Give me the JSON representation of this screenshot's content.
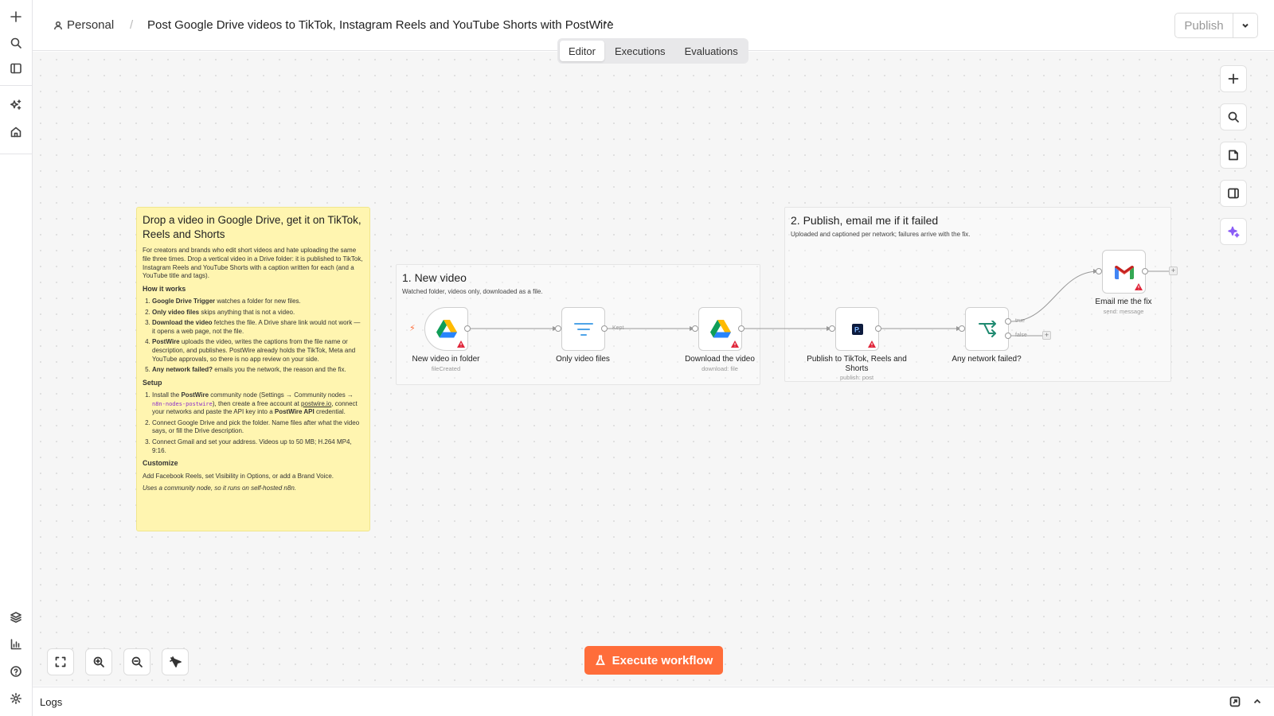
{
  "header": {
    "breadcrumb_project": "Personal",
    "breadcrumb_separator": "/",
    "workflow_title": "Post Google Drive videos to TikTok, Instagram Reels and YouTube Shorts with PostWire",
    "more_label": "···",
    "publish_label": "Publish"
  },
  "tabs": [
    "Editor",
    "Executions",
    "Evaluations"
  ],
  "active_tab": "Editor",
  "sticky": {
    "title": "Drop a video in Google Drive, get it on TikTok, Reels and Shorts",
    "intro": "For creators and brands who edit short videos and hate uploading the same file three times. Drop a vertical video in a Drive folder: it is published to TikTok, Instagram Reels and YouTube Shorts with a caption written for each (and a YouTube title and tags).",
    "how_heading": "How it works",
    "how_items": [
      {
        "b": "Google Drive Trigger",
        "t": " watches a folder for new files."
      },
      {
        "b": "Only video files",
        "t": " skips anything that is not a video."
      },
      {
        "b": "Download the video",
        "t": " fetches the file. A Drive share link would not work — it opens a web page, not the file."
      },
      {
        "b": "PostWire",
        "t": " uploads the video, writes the captions from the file name or description, and publishes. PostWire already holds the TikTok, Meta and YouTube approvals, so there is no app review on your side."
      },
      {
        "b": "Any network failed?",
        "t": " emails you the network, the reason and the fix."
      }
    ],
    "setup_heading": "Setup",
    "setup_1_a": "Install the ",
    "setup_1_b": "PostWire",
    "setup_1_c": " community node (Settings → Community nodes → ",
    "setup_1_code": "n8n-nodes-postwire",
    "setup_1_d": "), then create a free account at ",
    "setup_1_link": "postwire.io",
    "setup_1_e": ", connect your networks and paste the API key into a ",
    "setup_1_f": "PostWire API",
    "setup_1_g": " credential.",
    "setup_2": "Connect Google Drive and pick the folder. Name files after what the video says, or fill the Drive description.",
    "setup_3": "Connect Gmail and set your address. Videos up to 50 MB; H.264 MP4, 9:16.",
    "customize_heading": "Customize",
    "customize_text": "Add Facebook Reels, set Visibility in Options, or add a Brand Voice.",
    "footer_note": "Uses a community node, so it runs on self-hosted n8n."
  },
  "groups": {
    "g1_title": "1. New video",
    "g1_desc": "Watched folder, videos only, downloaded as a file.",
    "g2_title": "2. Publish, email me if it failed",
    "g2_desc": "Uploaded and captioned per network; failures arrive with the fix."
  },
  "nodes": {
    "n1_label": "New video in folder",
    "n1_sub": "fileCreated",
    "n2_label": "Only video files",
    "n3_label": "Download the video",
    "n3_sub": "download: file",
    "n4_label": "Publish to TikTok, Reels and Shorts",
    "n4_sub": "publish: post",
    "n5_label": "Any network failed?",
    "n6_label": "Email me the fix",
    "n6_sub": "send: message"
  },
  "edge_labels": {
    "kept": "Kept",
    "true": "true",
    "false": "false"
  },
  "execute_label": "Execute workflow",
  "logs_label": "Logs",
  "colors": {
    "accent": "#ff6d3a",
    "sticky": "#fff5b0",
    "canvas": "#f6f6f6"
  },
  "icons": [
    "plus-icon",
    "search-icon",
    "sidebar-icon",
    "sparkle-icon",
    "home-icon",
    "layers-icon",
    "chart-icon",
    "help-icon",
    "gear-icon",
    "google-drive-icon",
    "filter-icon",
    "postwire-icon",
    "if-icon",
    "gmail-icon",
    "flask-icon"
  ]
}
